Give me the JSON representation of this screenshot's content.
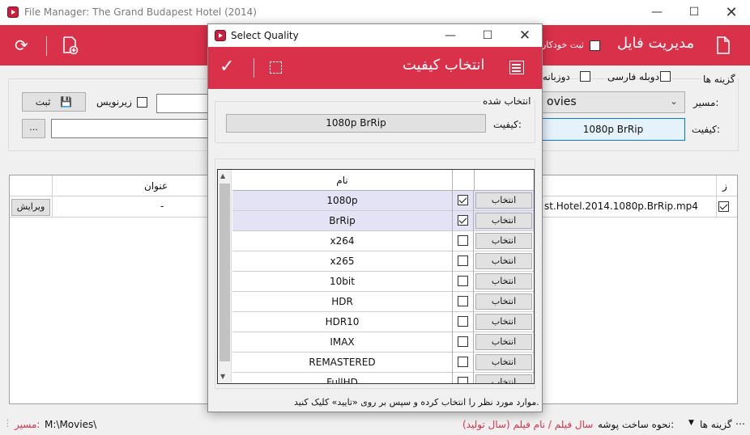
{
  "main": {
    "title": "File Manager: The Grand Budapest Hotel (2014)",
    "header_title": "مدیریت فایل",
    "auto_save_label": "ثبت خودکار",
    "options_label": "گزینه ها",
    "persian_dub_label": "دوبله فارسی",
    "bilingual_label": "دوزبانه",
    "path_label": "مسیر:",
    "path_value": "ovies",
    "quality_label": "کیفیت:",
    "quality_value": "1080p BrRip",
    "subtitle_label": "زیرنویس",
    "save_label": "ثبت",
    "browse_label": "...",
    "table": {
      "col_title": "عنوان",
      "col_z": "ز",
      "row_file": "st.Hotel.2014.1080p.BrRip.mp4",
      "row_title": "-",
      "row_edit": "ویرایش"
    }
  },
  "status": {
    "path_label": "مسیر:",
    "path_value": "M:\\Movies\\",
    "folder_mode_label": "نحوه ساخت پوشه:",
    "folder_mode_value": "سال فیلم / نام فیلم (سال تولید)",
    "options_label": "گزینه ها"
  },
  "dialog": {
    "title": "Select Quality",
    "header_title": "انتخاب کیفیت",
    "selected_group": "انتخاب شده",
    "quality_label": "کیفیت:",
    "quality_value": "1080p BrRip",
    "col_name": "نام",
    "select_label": "انتخاب",
    "items": [
      {
        "name": "1080p",
        "checked": true
      },
      {
        "name": "BrRip",
        "checked": true
      },
      {
        "name": "x264",
        "checked": false
      },
      {
        "name": "x265",
        "checked": false
      },
      {
        "name": "10bit",
        "checked": false
      },
      {
        "name": "HDR",
        "checked": false
      },
      {
        "name": "HDR10",
        "checked": false
      },
      {
        "name": "IMAX",
        "checked": false
      },
      {
        "name": "REMASTERED",
        "checked": false
      },
      {
        "name": "FullHD",
        "checked": false
      }
    ],
    "hint": "موارد مورد نظر را انتخاب کرده و سپس بر روی «تایید» کلیک کنید."
  },
  "colors": {
    "accent": "#d9314a"
  }
}
